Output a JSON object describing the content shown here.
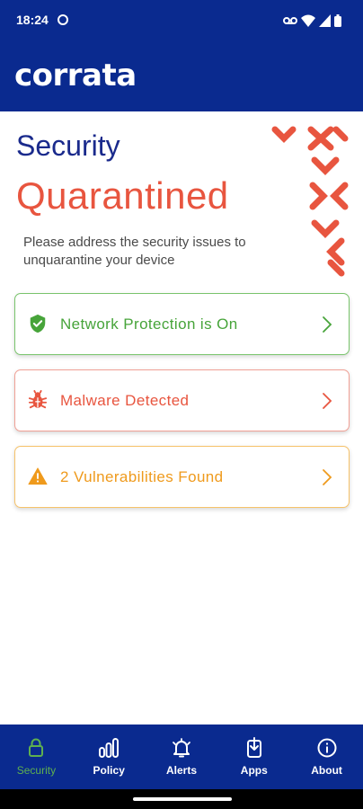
{
  "status_bar": {
    "time": "18:24",
    "icons": [
      "settings-dot-icon",
      "voicemail-icon",
      "wifi-icon",
      "signal-icon",
      "battery-icon"
    ]
  },
  "header": {
    "brand": "corrata",
    "brand_color": "#0a2a8f"
  },
  "main": {
    "section_title": "Security",
    "status": "Quarantined",
    "description": "Please address the security issues to unquarantine your device",
    "cards": [
      {
        "label": "Network Protection is On",
        "icon": "shield-check-icon",
        "color": "#47a43a"
      },
      {
        "label": "Malware Detected",
        "icon": "bug-icon",
        "color": "#e8553f"
      },
      {
        "label": "2 Vulnerabilities Found",
        "icon": "warning-icon",
        "color": "#ef9a1c"
      }
    ]
  },
  "bottom_nav": {
    "active": "Security",
    "items": [
      {
        "label": "Security",
        "icon": "lock-icon"
      },
      {
        "label": "Policy",
        "icon": "bar-chart-icon"
      },
      {
        "label": "Alerts",
        "icon": "bell-icon"
      },
      {
        "label": "Apps",
        "icon": "app-download-icon"
      },
      {
        "label": "About",
        "icon": "info-icon"
      }
    ]
  },
  "colors": {
    "primary": "#0a2a8f",
    "danger": "#e8553f",
    "success": "#47a43a",
    "warning": "#ef9a1c"
  }
}
